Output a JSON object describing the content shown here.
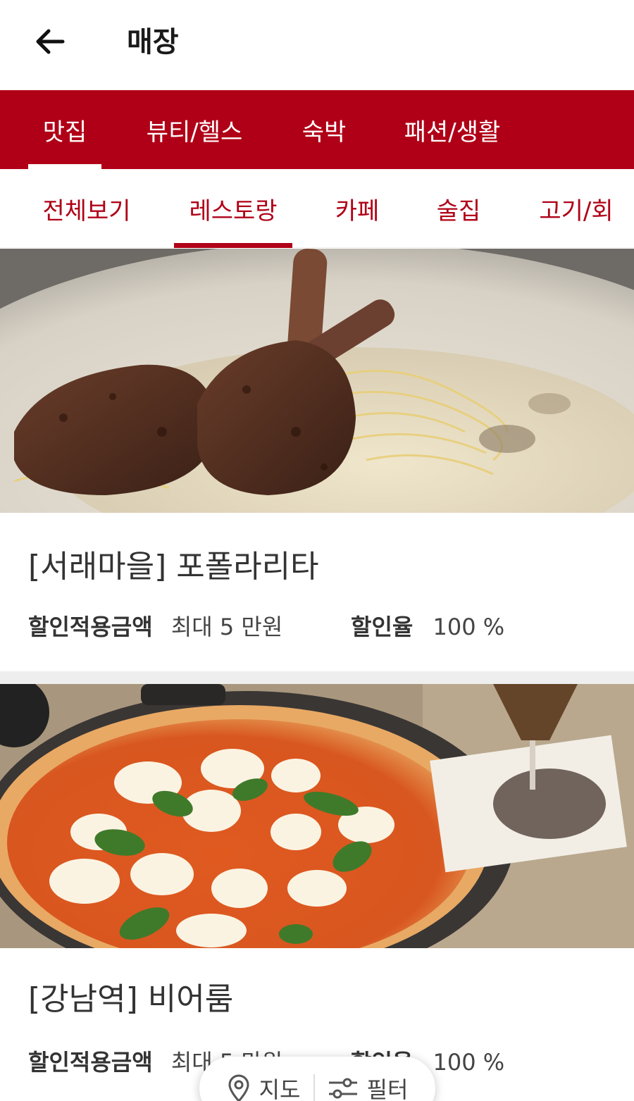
{
  "header": {
    "title": "매장",
    "back_icon": "arrow-left-icon"
  },
  "category_tabs": [
    {
      "label": "맛집",
      "active": true
    },
    {
      "label": "뷰티/헬스",
      "active": false
    },
    {
      "label": "숙박",
      "active": false
    },
    {
      "label": "패션/생활",
      "active": false
    }
  ],
  "sub_tabs": [
    {
      "label": "전체보기",
      "active": false
    },
    {
      "label": "레스토랑",
      "active": true
    },
    {
      "label": "카페",
      "active": false
    },
    {
      "label": "술집",
      "active": false
    },
    {
      "label": "고기/회",
      "active": false
    }
  ],
  "stores": [
    {
      "name": "[서래마을] 포폴라리타",
      "discount_amount_label": "할인적용금액",
      "discount_amount_value": "최대 5 만원",
      "discount_rate_label": "할인율",
      "discount_rate_value": "100 %",
      "image_icon": "lamb-chop-pasta-photo"
    },
    {
      "name": "[강남역] 비어룸",
      "discount_amount_label": "할인적용금액",
      "discount_amount_value": "최대 5 만원",
      "discount_rate_label": "할인율",
      "discount_rate_value": "100 %",
      "image_icon": "margherita-pizza-photo"
    }
  ],
  "float_bar": {
    "map_label": "지도",
    "map_icon": "map-pin-icon",
    "filter_label": "필터",
    "filter_icon": "sliders-icon"
  },
  "colors": {
    "brand": "#b00017",
    "white": "#ffffff",
    "text": "#333333"
  }
}
